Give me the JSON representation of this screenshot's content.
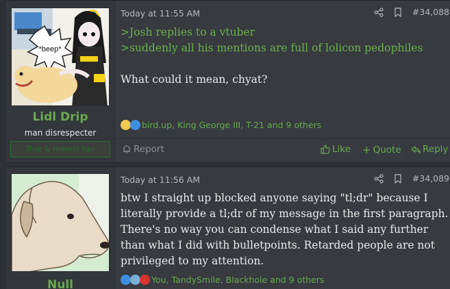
{
  "posts": [
    {
      "username": "Lidl Drip",
      "user_title": "man disrespecter",
      "user_banner": "True & Honest Fan",
      "date": "Today at 11:55 AM",
      "post_number": "#34,088",
      "greentext_lines": [
        ">Josh replies to a vtuber",
        ">suddenly all his mentions are full of lolicon pedophiles"
      ],
      "body": "What could it mean, chyat?",
      "avatar_text": "*beep*",
      "reactions_text": "bird.up, King George III, T-21 and 9 others",
      "actions": {
        "report": "Report",
        "like": "Like",
        "quote": "Quote",
        "reply": "Reply"
      }
    },
    {
      "username": "Null",
      "date": "Today at 11:56 AM",
      "post_number": "#34,089",
      "body": "btw I straight up blocked anyone saying \"tl;dr\" because I literally provide a tl;dr of my message in the first paragraph. There's no way you can condense what I said any further than what I did with bulletpoints. Retarded people are not privileged to my attention.",
      "reactions_text": "You, TandySmile, Blackhole and 9 others"
    }
  ],
  "colors": {
    "background": "#2d3136",
    "post_bg": "#373b40",
    "username": "#6aa84f",
    "greentext": "#6ab04c",
    "muted": "#8a8f94"
  }
}
